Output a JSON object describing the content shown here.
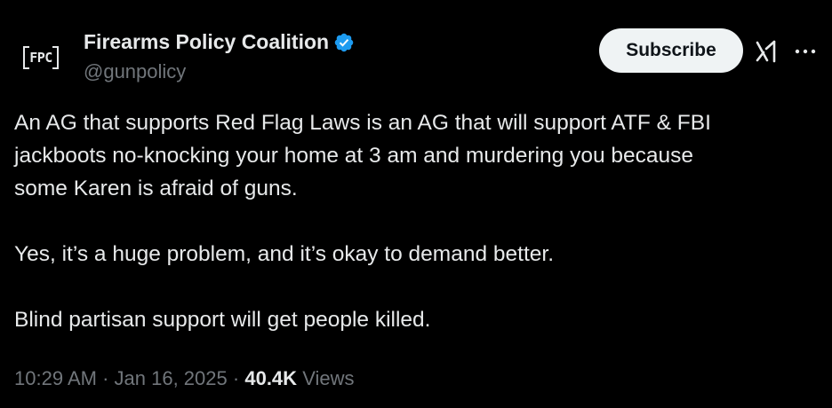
{
  "author": {
    "avatar_text": "FPC",
    "display_name": "Firearms Policy Coalition",
    "handle": "@gunpolicy",
    "verified": true,
    "verified_color": "#1d9bf0"
  },
  "actions": {
    "subscribe_label": "Subscribe",
    "grok_icon": "grok-icon",
    "more_icon": "more-options-icon"
  },
  "tweet": {
    "lines": [
      "An AG that supports Red Flag Laws is an AG that will support ATF & FBI",
      "jackboots no-knocking your home at 3 am and murdering you because",
      "some Karen is afraid of guns.",
      "Yes, it’s a huge problem, and it’s okay to demand better.",
      "Blind partisan support will get people killed."
    ]
  },
  "meta": {
    "time": "10:29 AM",
    "separator": "·",
    "date": "Jan 16, 2025",
    "views_count": "40.4K",
    "views_label": "Views"
  },
  "colors": {
    "background": "#000000",
    "text_primary": "#e7e9ea",
    "text_secondary": "#71767b",
    "subscribe_bg": "#eff3f4"
  }
}
